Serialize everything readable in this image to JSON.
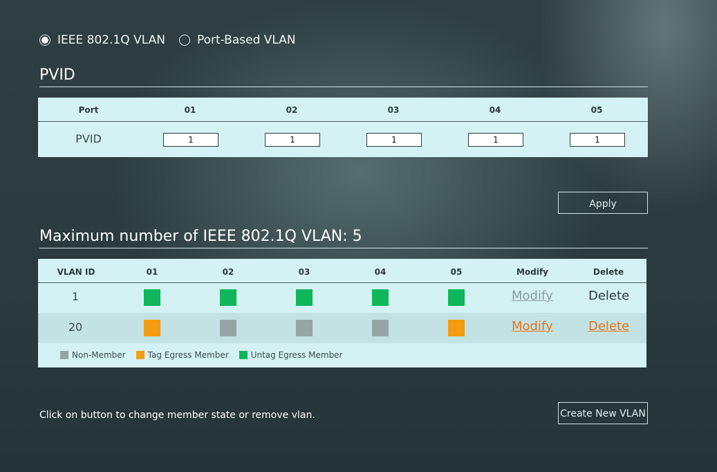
{
  "mode": {
    "options": [
      {
        "label": "IEEE 802.1Q VLAN",
        "selected": true
      },
      {
        "label": "Port-Based VLAN",
        "selected": false
      }
    ]
  },
  "pvid": {
    "title": "PVID",
    "port_header": "Port",
    "ports": [
      "01",
      "02",
      "03",
      "04",
      "05"
    ],
    "row_label": "PVID",
    "values": [
      "1",
      "1",
      "1",
      "1",
      "1"
    ]
  },
  "apply_label": "Apply",
  "vlan": {
    "title": "Maximum number of IEEE 802.1Q VLAN: 5",
    "headers": {
      "vlan_id": "VLAN ID",
      "ports": [
        "01",
        "02",
        "03",
        "04",
        "05"
      ],
      "modify": "Modify",
      "delete": "Delete"
    },
    "rows": [
      {
        "id": "1",
        "members": [
          "untag",
          "untag",
          "untag",
          "untag",
          "untag"
        ],
        "modify": "Modify",
        "delete": "Delete",
        "modify_enabled": false,
        "delete_enabled": false
      },
      {
        "id": "20",
        "members": [
          "tag",
          "non",
          "non",
          "non",
          "tag"
        ],
        "modify": "Modify",
        "delete": "Delete",
        "modify_enabled": true,
        "delete_enabled": true
      }
    ],
    "legend": {
      "non": "Non-Member",
      "tag": "Tag Egress Member",
      "untag": "Untag Egress Member"
    }
  },
  "colors": {
    "non": "#95a5a6",
    "tag": "#f39c12",
    "untag": "#0fb75a",
    "link_active": "#e8731a",
    "link_disabled": "#8a9c9e"
  },
  "hint": "Click on button to change member state or remove vlan.",
  "create_label": "Create New VLAN"
}
